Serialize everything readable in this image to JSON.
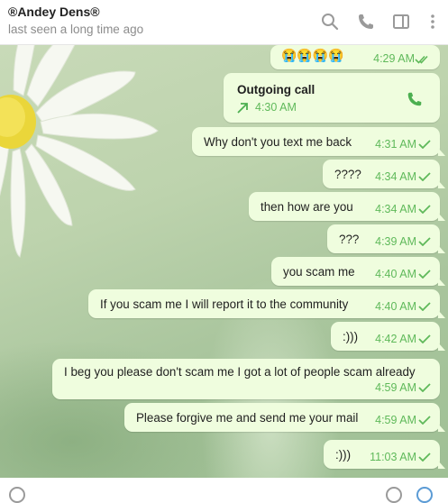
{
  "header": {
    "contact_name": "®Andey Dens®",
    "status": "last seen a long time ago",
    "icons": [
      "search-icon",
      "phone-icon",
      "sidebar-icon",
      "more-icon"
    ]
  },
  "messages": [
    {
      "text": "😭😭😭😭",
      "time": "4:29 AM",
      "status": "read"
    },
    {
      "type": "call",
      "title": "Outgoing call",
      "time": "4:30 AM"
    },
    {
      "text": "Why don't you text me back",
      "time": "4:31 AM",
      "status": "sent"
    },
    {
      "text": "????",
      "time": "4:34 AM",
      "status": "sent"
    },
    {
      "text": "then how are you",
      "time": "4:34 AM",
      "status": "sent"
    },
    {
      "text": "???",
      "time": "4:39 AM",
      "status": "sent"
    },
    {
      "text": "you scam me",
      "time": "4:40 AM",
      "status": "sent"
    },
    {
      "text": "If you scam me I will report it to the community",
      "time": "4:40 AM",
      "status": "sent"
    },
    {
      "text": ":)))",
      "time": "4:42 AM",
      "status": "sent"
    },
    {
      "text": "I beg you please don't scam me I got a lot of people scam already",
      "time": "4:59 AM",
      "status": "sent"
    },
    {
      "text": "Please forgive me and send me your mail",
      "time": "4:59 AM",
      "status": "sent"
    },
    {
      "text": ":)))",
      "time": "11:03 AM",
      "status": "sent"
    }
  ],
  "colors": {
    "accent": "#5fb95a",
    "bubble": "#effdde",
    "call_arrow": "#4caf50"
  }
}
